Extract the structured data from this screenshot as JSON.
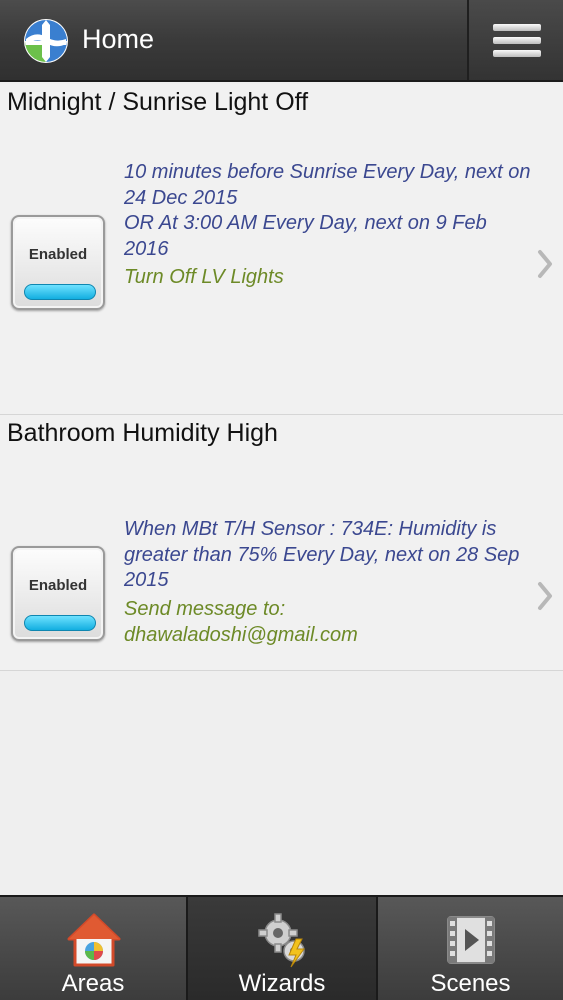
{
  "header": {
    "title": "Home",
    "logo_icon": "globe-logo-icon",
    "menu_icon": "hamburger-menu-icon"
  },
  "rules": [
    {
      "title": "Midnight / Sunrise Light Off",
      "toggle_label": "Enabled",
      "enabled": true,
      "condition": "10 minutes before Sunrise Every Day, next on 24 Dec 2015\n OR At 3:00 AM Every Day, next on 9 Feb 2016",
      "action": "Turn Off LV Lights"
    },
    {
      "title": "Bathroom Humidity High",
      "toggle_label": "Enabled",
      "enabled": true,
      "condition": "When  MBt T/H Sensor : 734E:  Humidity is greater than 75%    Every Day, next on 28 Sep 2015",
      "action": "Send message to:\ndhawaladoshi@gmail.com"
    }
  ],
  "tabs": [
    {
      "label": "Areas",
      "icon": "house-icon",
      "active": false
    },
    {
      "label": "Wizards",
      "icon": "gears-icon",
      "active": true
    },
    {
      "label": "Scenes",
      "icon": "film-icon",
      "active": false
    }
  ],
  "colors": {
    "condition_text": "#3b4890",
    "action_text": "#6d8a27",
    "toggle_led": "#12aee0",
    "header_bg": "#3a3a3a"
  }
}
